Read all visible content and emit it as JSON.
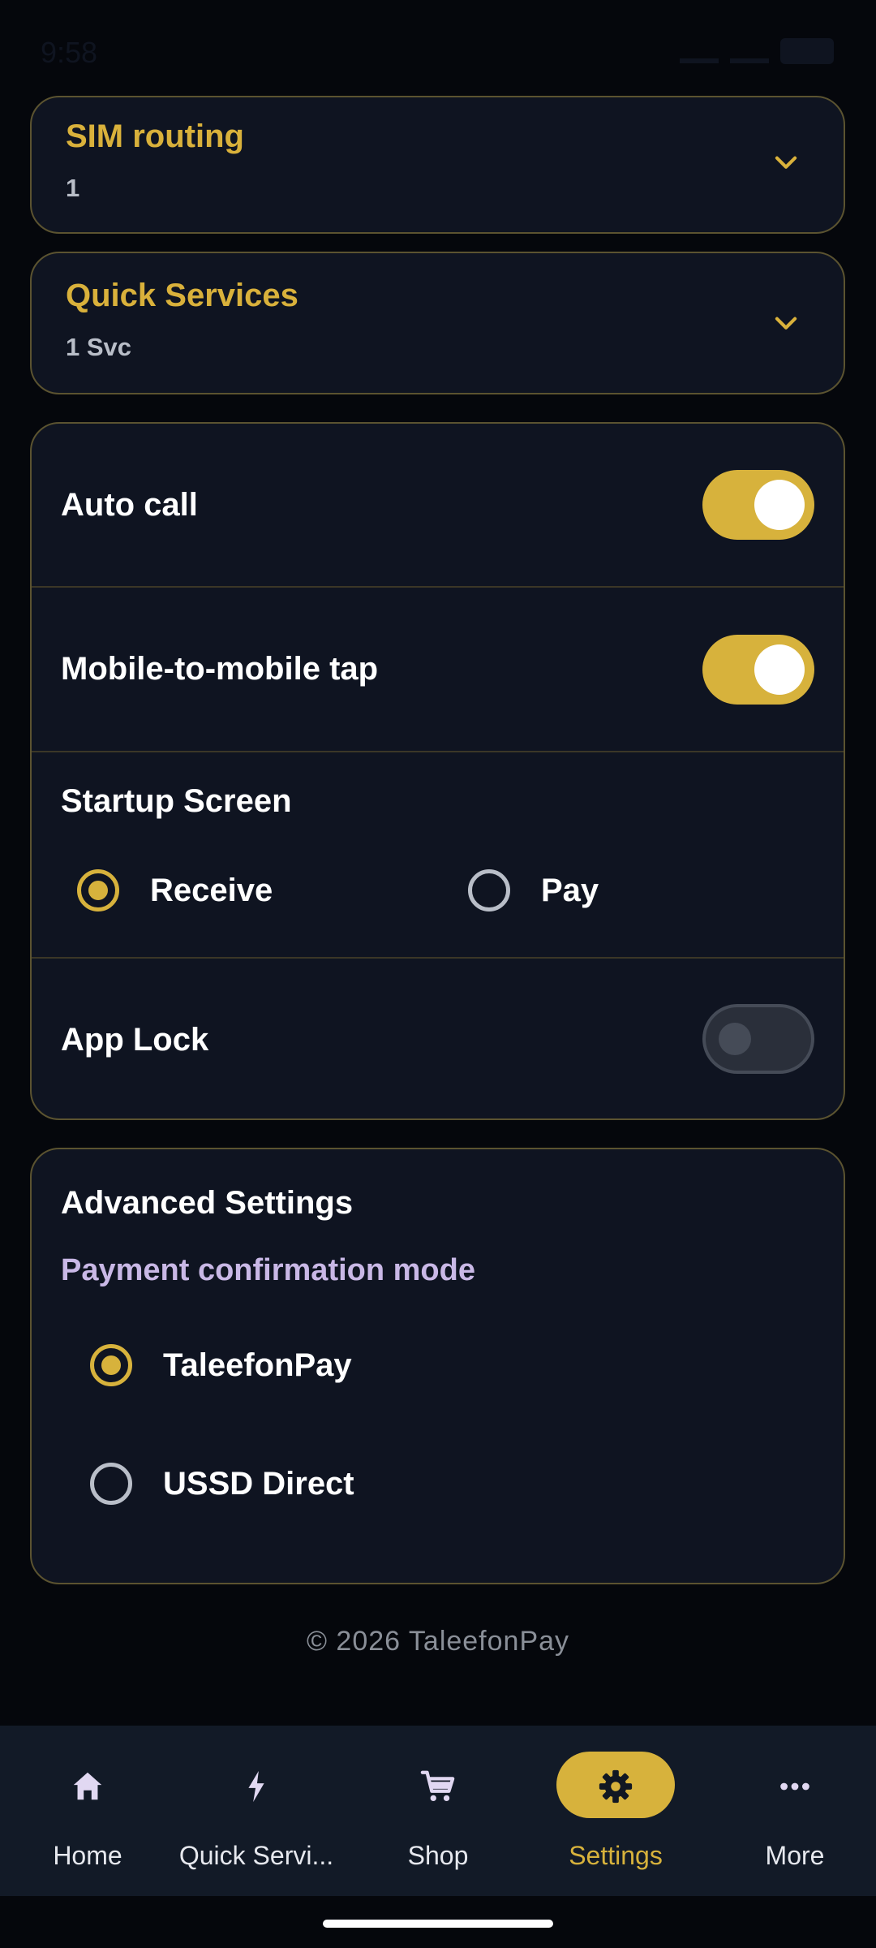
{
  "status_bar": {
    "time": "9:58"
  },
  "sim_routing": {
    "title": "SIM routing",
    "value": "1"
  },
  "quick_services": {
    "title": "Quick Services",
    "value": "1 Svc"
  },
  "toggles": {
    "auto_call": {
      "label": "Auto call",
      "on": true
    },
    "mobile_tap": {
      "label": "Mobile-to-mobile tap",
      "on": true
    },
    "app_lock": {
      "label": "App Lock",
      "on": false
    }
  },
  "startup_screen": {
    "title": "Startup Screen",
    "options": [
      {
        "label": "Receive",
        "selected": true
      },
      {
        "label": "Pay",
        "selected": false
      }
    ]
  },
  "advanced": {
    "title": "Advanced Settings",
    "subtitle": "Payment confirmation mode",
    "options": [
      {
        "label": "TaleefonPay",
        "selected": true
      },
      {
        "label": "USSD Direct",
        "selected": false
      }
    ]
  },
  "footer": {
    "copyright": "© 2026 TaleefonPay"
  },
  "nav": {
    "items": [
      {
        "label": "Home",
        "icon": "home-icon"
      },
      {
        "label": "Quick Servi...",
        "icon": "bolt-icon"
      },
      {
        "label": "Shop",
        "icon": "cart-icon"
      },
      {
        "label": "Settings",
        "icon": "gear-icon",
        "active": true
      },
      {
        "label": "More",
        "icon": "more-icon"
      }
    ]
  },
  "colors": {
    "accent": "#d7b23c",
    "card": "#0f1421",
    "background": "#05070c",
    "border": "#5b5330"
  }
}
